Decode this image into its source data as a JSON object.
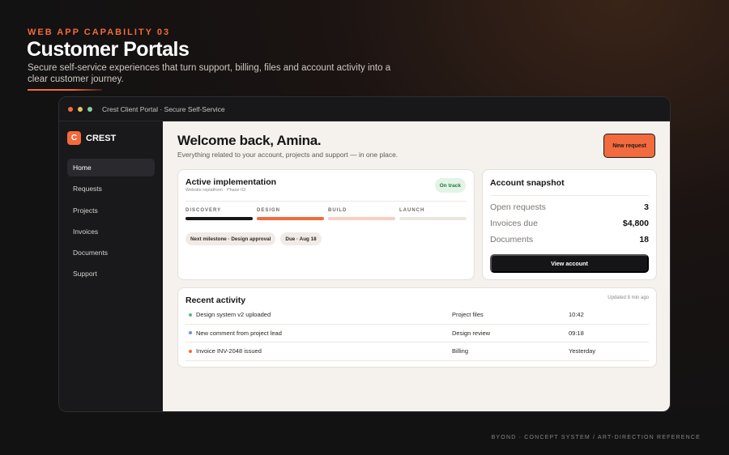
{
  "hero": {
    "eyebrow": "WEB APP CAPABILITY 03",
    "title": "Customer Portals",
    "subtitle": "Secure self-service experiences that turn support, billing, files and account activity into a clear customer journey."
  },
  "footer": "BYOND · CONCEPT SYSTEM / ART-DIRECTION REFERENCE",
  "window": {
    "title": "Crest Client Portal · Secure Self-Service",
    "dots": [
      "#f26a3d",
      "#e9c25a",
      "#7fd09a"
    ]
  },
  "sidebar": {
    "brand_mark": "C",
    "brand_name": "CREST",
    "items": [
      {
        "label": "Home",
        "active": true
      },
      {
        "label": "Requests"
      },
      {
        "label": "Projects"
      },
      {
        "label": "Invoices"
      },
      {
        "label": "Documents"
      },
      {
        "label": "Support"
      }
    ]
  },
  "main": {
    "welcome": "Welcome back, Amina.",
    "welcome_sub": "Everything related to your account, projects and support — in one place.",
    "new_request_label": "New request"
  },
  "implementation": {
    "title": "Active implementation",
    "subtitle": "Website replatform · Phase 03",
    "status": "On track",
    "phases": [
      {
        "label": "DISCOVERY",
        "color": "#161616"
      },
      {
        "label": "DESIGN",
        "color": "#f26a3d"
      },
      {
        "label": "BUILD",
        "color": "#f8cfc0"
      },
      {
        "label": "LAUNCH",
        "color": "#ece6e0"
      }
    ],
    "milestone": "Next milestone · Design approval",
    "due": "Due · Aug 18"
  },
  "snapshot": {
    "title": "Account snapshot",
    "rows": [
      {
        "label": "Open requests",
        "value": "3"
      },
      {
        "label": "Invoices due",
        "value": "$4,800"
      },
      {
        "label": "Documents",
        "value": "18"
      }
    ],
    "button_label": "View account"
  },
  "activity": {
    "title": "Recent activity",
    "updated": "Updated 8 min ago",
    "rows": [
      {
        "name": "Design system v2 uploaded",
        "category": "Project files",
        "time": "10:42",
        "dot": "#5bb97a"
      },
      {
        "name": "New comment from project lead",
        "category": "Design review",
        "time": "09:18",
        "dot": "#6f8fe8"
      },
      {
        "name": "Invoice INV-2048 issued",
        "category": "Billing",
        "time": "Yesterday",
        "dot": "#f26a3d"
      }
    ]
  },
  "colors": {
    "accent": "#f26a3d",
    "dark": "#151517",
    "panel": "#f5f2ee",
    "success": "#1f7a3d"
  }
}
